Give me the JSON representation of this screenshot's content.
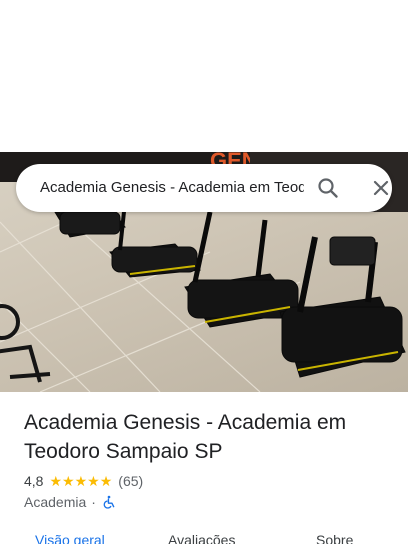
{
  "search": {
    "query": "Academia Genesis - Academia em Teodoro Sampaio SP",
    "search_icon": "search-icon",
    "close_icon": "close-icon"
  },
  "hero": {
    "image": "gym-treadmills-photo"
  },
  "place": {
    "name": "Academia Genesis - Academia em Teodoro Sampaio SP",
    "rating": "4,8",
    "rating_value": 4.8,
    "stars_max": 5,
    "review_count": "(65)",
    "category": "Academia",
    "separator": "·",
    "accessibility_icon": "wheelchair-icon"
  },
  "tabs": [
    {
      "label": "Visão geral",
      "active": true
    },
    {
      "label": "Avaliações",
      "active": false
    },
    {
      "label": "Sobre",
      "active": false
    }
  ],
  "colors": {
    "accent": "#1a73e8",
    "star": "#fbbc04",
    "text": "#202124",
    "secondary": "#5f6368"
  }
}
